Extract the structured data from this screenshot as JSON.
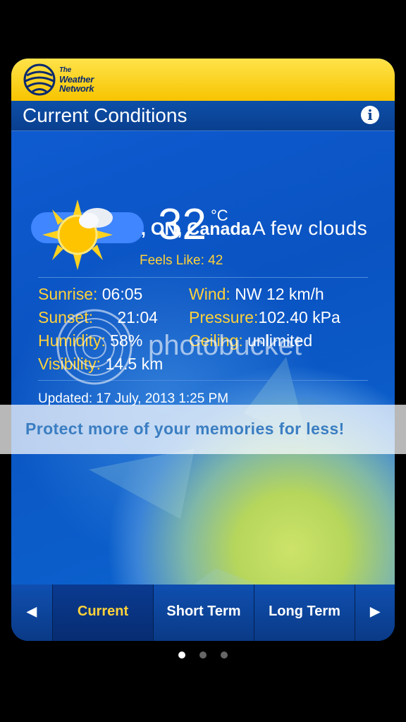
{
  "brand": {
    "line1": "The",
    "line2": "Weather",
    "line3": "Network"
  },
  "header": {
    "title": "Current Conditions",
    "info_icon": "info-icon"
  },
  "location": {
    "suffix": ", ON, Canada"
  },
  "current": {
    "temperature": "32",
    "unit": "°C",
    "condition": "A few clouds",
    "feels_like": "Feels Like: 42",
    "icon": "sun-with-cloud-icon"
  },
  "details": {
    "sunrise_label": "Sunrise:",
    "sunrise": "06:05",
    "sunset_label": "Sunset:",
    "sunset": "21:04",
    "humidity_label": "Humidity:",
    "humidity": "58%",
    "visibility_label": "Visibility:",
    "visibility": "14.5 km",
    "wind_label": "Wind:",
    "wind": "NW 12 km/h",
    "pressure_label": "Pressure:",
    "pressure": "102.40 kPa",
    "ceiling_label": "Ceiling:",
    "ceiling": "unlimited"
  },
  "updated": "Updated: 17 July, 2013 1:25 PM",
  "watermark": {
    "logo": "photobucket",
    "banner": "Protect more of your memories for less!"
  },
  "tabs": [
    {
      "label": "Current",
      "active": true
    },
    {
      "label": "Short Term",
      "active": false
    },
    {
      "label": "Long Term",
      "active": false
    }
  ],
  "nav": {
    "prev_icon": "chevron-left-icon",
    "next_icon": "chevron-right-icon"
  },
  "pagination": {
    "pages": 3,
    "current": 1
  },
  "colors": {
    "accent": "#ffd23a",
    "brand_yellow": "#f7c400",
    "panel_blue": "#0a58c0"
  }
}
